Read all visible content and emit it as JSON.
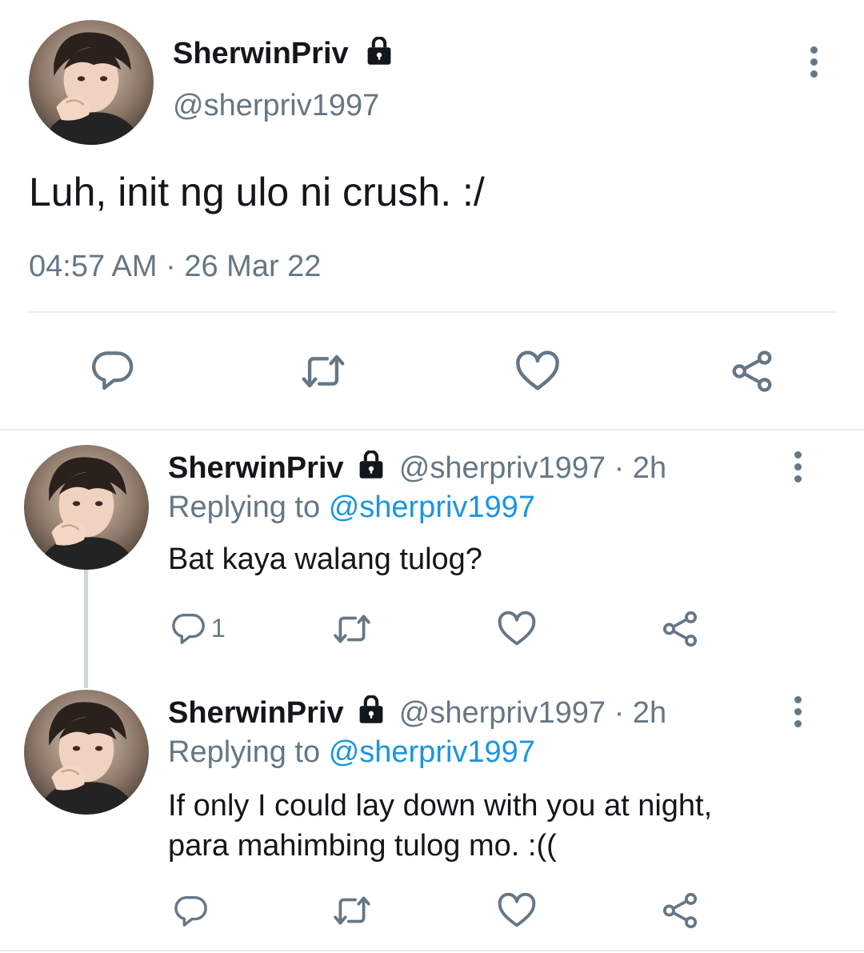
{
  "main_tweet": {
    "display_name": "SherwinPriv",
    "handle": "@sherpriv1997",
    "text": "Luh, init ng ulo ni crush. :/",
    "time": "04:57 AM",
    "separator": "·",
    "date": "26 Mar 22",
    "icons": [
      "reply-icon",
      "retweet-icon",
      "like-icon",
      "share-icon"
    ]
  },
  "replies": [
    {
      "display_name": "SherwinPriv",
      "handle": "@sherpriv1997",
      "age": "· 2h",
      "replying_prefix": "Replying to",
      "replying_to": "@sherpriv1997",
      "text": "Bat kaya walang tulog?",
      "reply_count": "1"
    },
    {
      "display_name": "SherwinPriv",
      "handle": "@sherpriv1997",
      "age": "· 2h",
      "replying_prefix": "Replying to",
      "replying_to": "@sherpriv1997",
      "text_line1": "If only I could lay down with you at night,",
      "text_line2": "para mahimbing tulog mo. :(("
    }
  ],
  "colors": {
    "text": "#14171a",
    "secondary": "#657786",
    "link": "#1b95e0",
    "divider": "#e6ecf0",
    "thread_line": "#ccd6dd"
  }
}
